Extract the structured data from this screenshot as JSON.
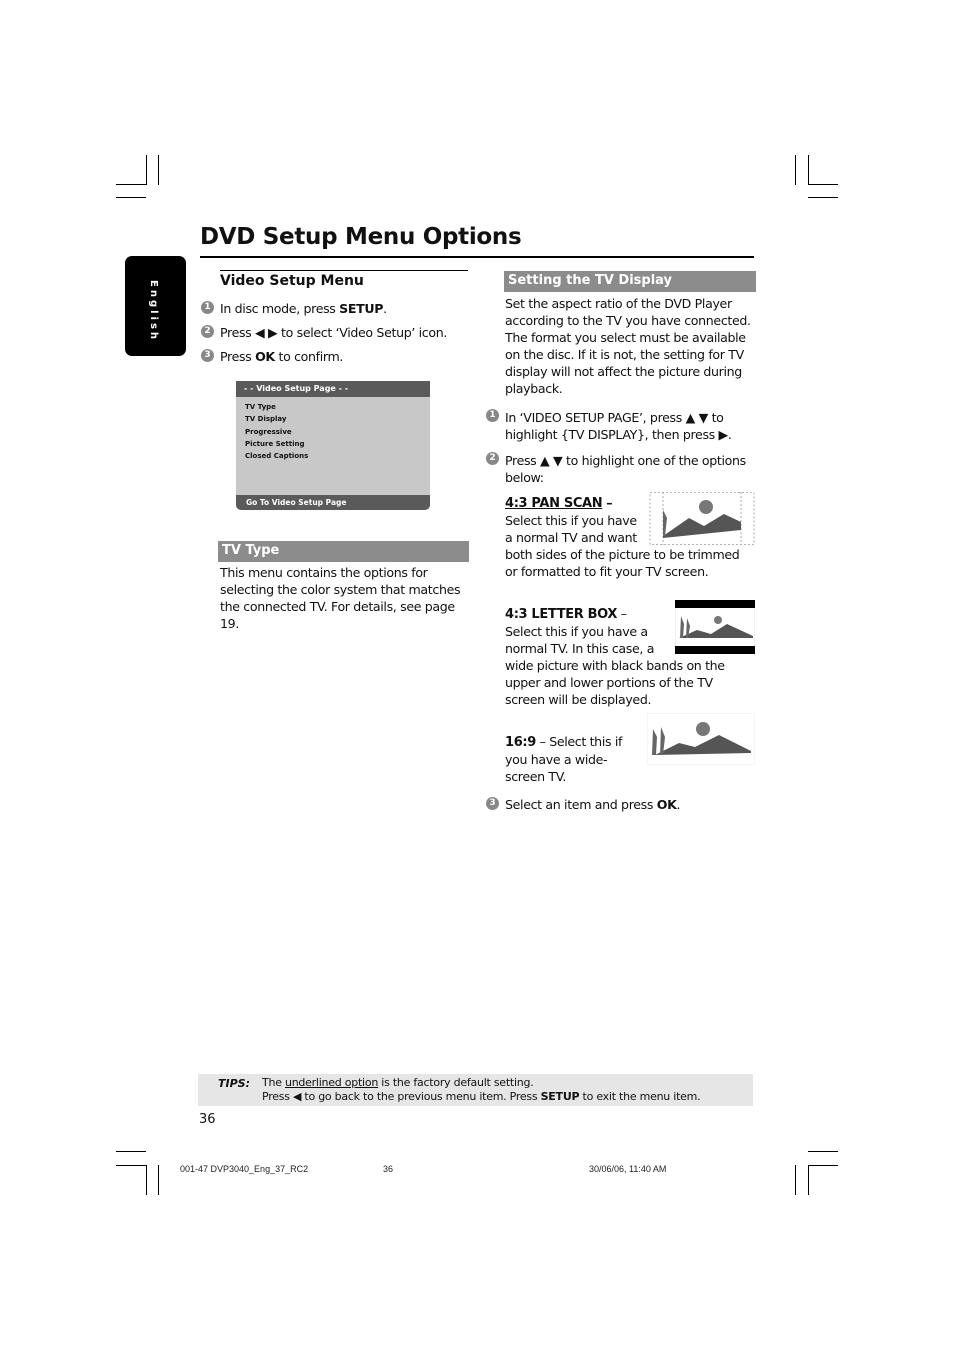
{
  "page": {
    "title": "DVD Setup Menu Options",
    "language_tab": "English",
    "page_number": "36"
  },
  "video_setup": {
    "heading": "Video Setup Menu",
    "steps": [
      {
        "num": "1",
        "pre": "In disc mode, press ",
        "bold": "SETUP",
        "post": "."
      },
      {
        "num": "2",
        "pre": "Press ◀ ▶ to select ‘Video Setup’ icon.",
        "bold": "",
        "post": ""
      },
      {
        "num": "3",
        "pre": "Press ",
        "bold": "OK",
        "post": " to confirm."
      }
    ],
    "osd": {
      "header": "- -   Video Setup Page   - -",
      "items": [
        "TV Type",
        "TV Display",
        "Progressive",
        "Picture Setting",
        "Closed Captions"
      ],
      "footer": "Go To Video Setup Page"
    }
  },
  "tv_type": {
    "heading": "TV Type",
    "text": "This menu contains the options for selecting the color system that matches the connected TV.  For details, see page 19."
  },
  "tv_display": {
    "heading": "Setting the TV Display",
    "intro": "Set the aspect ratio of the DVD Player according to the TV you have connected. The format you select must be available on the disc.  If it is not, the setting for TV display will not affect the picture during playback.",
    "step1": {
      "num": "1",
      "text": "In ‘VIDEO SETUP PAGE’, press ▲ ▼ to highlight {TV DISPLAY}, then press ▶."
    },
    "step2": {
      "num": "2",
      "text": "Press ▲ ▼ to highlight one of the options below:"
    },
    "options": [
      {
        "label": "4:3 PAN SCAN",
        "sep": " –",
        "text": "Select this if you have a normal TV and want both sides of the picture to be trimmed or formatted to fit your TV screen.",
        "default": true,
        "icon": "pan-scan-picture"
      },
      {
        "label": "4:3 LETTER BOX",
        "sep": " –",
        "text": "Select this if you have a normal TV. In this case, a wide picture with black bands on the upper and lower portions of the TV screen will be displayed.",
        "default": false,
        "icon": "letter-box-picture"
      },
      {
        "label": "16:9",
        "sep": " – Select this if you have a wide-screen TV.",
        "text": "",
        "default": false,
        "icon": "widescreen-picture"
      }
    ],
    "step3": {
      "num": "3",
      "pre": "Select an item and press ",
      "bold": "OK",
      "post": "."
    }
  },
  "tips": {
    "label": "TIPS:",
    "line1_pre": "The ",
    "line1_u": "underlined option",
    "line1_post": " is the factory default setting.",
    "line2_pre": "Press ◀ to go back to the previous menu item. Press ",
    "line2_bold": "SETUP",
    "line2_post": " to exit the menu item."
  },
  "print_footer": {
    "file": "001-47 DVP3040_Eng_37_RC2",
    "page": "36",
    "date": "30/06/06, 11:40 AM"
  }
}
